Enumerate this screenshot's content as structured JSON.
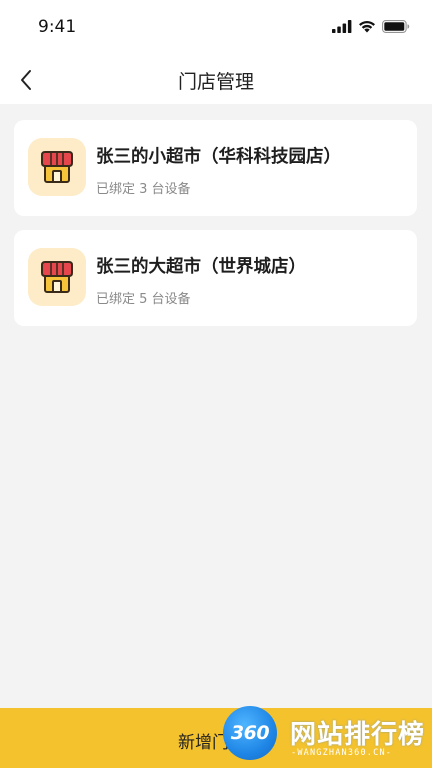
{
  "status_bar": {
    "time": "9:41"
  },
  "nav": {
    "title": "门店管理",
    "back_icon": "chevron-left-icon"
  },
  "stores": [
    {
      "name": "张三的小超市（华科科技园店）",
      "devices": "已绑定 3 台设备",
      "icon": "store-icon"
    },
    {
      "name": "张三的大超市（世界城店）",
      "devices": "已绑定 5 台设备",
      "icon": "store-icon"
    }
  ],
  "footer": {
    "add_label": "新增门店"
  },
  "watermark": {
    "badge": "360",
    "text": "网站排行榜",
    "sub": "-WANGZHAN360.CN-"
  },
  "colors": {
    "accent": "#f4c22d",
    "background": "#f3f3f3",
    "card": "#ffffff",
    "icon_bg": "#fdecc7",
    "awning": "#e5474d",
    "house": "#f6c43b"
  }
}
